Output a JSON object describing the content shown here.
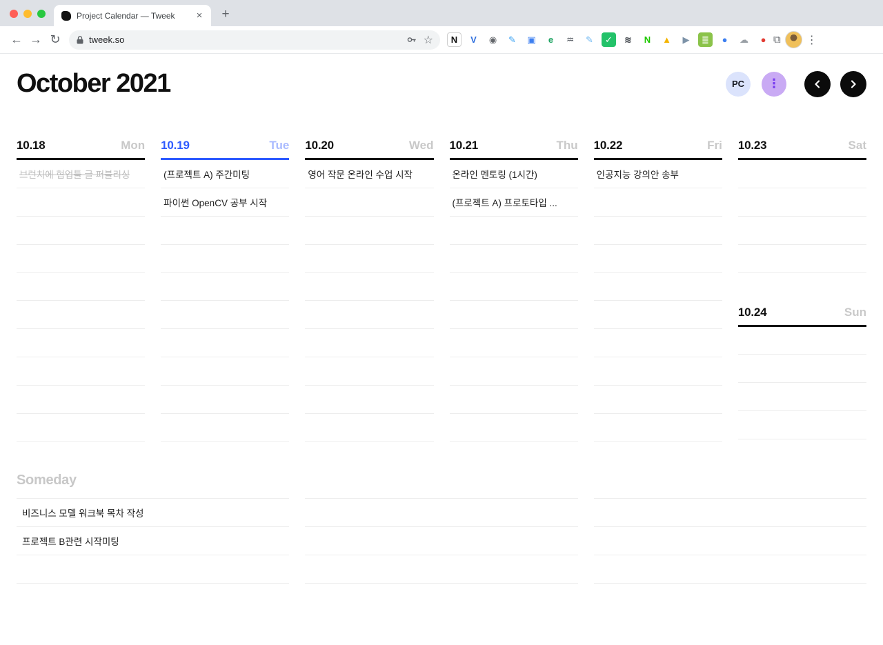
{
  "browser": {
    "tab": {
      "title": "Project Calendar — Tweek"
    },
    "new_tab_label": "+",
    "close_tab_label": "×",
    "url": "tweek.so",
    "nav": {
      "back": "←",
      "forward": "→",
      "reload": "↻"
    },
    "omnibox_icons": {
      "star": "☆"
    },
    "extensions": [
      {
        "name": "notion-extension-icon",
        "glyph": "N",
        "bg": "#ffffff",
        "fg": "#111111",
        "border": "#cfcfcf"
      },
      {
        "name": "v-blue-extension-icon",
        "glyph": "V",
        "bg": "#ffffff",
        "fg": "#2f6fde"
      },
      {
        "name": "camera-extension-icon",
        "glyph": "◉",
        "bg": "#ffffff",
        "fg": "#63666b"
      },
      {
        "name": "blue-pen-extension-icon",
        "glyph": "✎",
        "bg": "#ffffff",
        "fg": "#38a1f3"
      },
      {
        "name": "blue-app-extension-icon",
        "glyph": "▣",
        "bg": "#ffffff",
        "fg": "#3d7ff0"
      },
      {
        "name": "evernote-extension-icon",
        "glyph": "e",
        "bg": "#ffffff",
        "fg": "#1fa463"
      },
      {
        "name": "wave-extension-icon",
        "glyph": "♒",
        "bg": "#ffffff",
        "fg": "#444a52"
      },
      {
        "name": "feather-extension-icon",
        "glyph": "✎",
        "bg": "#ffffff",
        "fg": "#6db7f2"
      },
      {
        "name": "green-check-extension-icon",
        "glyph": "✓",
        "bg": "#23c269",
        "fg": "#ffffff"
      },
      {
        "name": "sound-wave-extension-icon",
        "glyph": "≋",
        "bg": "#ffffff",
        "fg": "#3a3f45"
      },
      {
        "name": "naver-extension-icon",
        "glyph": "N",
        "bg": "#ffffff",
        "fg": "#1ec800"
      },
      {
        "name": "drive-extension-icon",
        "glyph": "▲",
        "bg": "#ffffff",
        "fg": "#f4b400"
      },
      {
        "name": "send-extension-icon",
        "glyph": "▶",
        "bg": "#ffffff",
        "fg": "#7d93a8"
      },
      {
        "name": "note-extension-icon",
        "glyph": "≣",
        "bg": "#8bc34a",
        "fg": "#ffffff"
      },
      {
        "name": "blue-dot-extension-icon",
        "glyph": "●",
        "bg": "#ffffff",
        "fg": "#3d7ff0"
      },
      {
        "name": "cloud-extension-icon",
        "glyph": "☁",
        "bg": "#ffffff",
        "fg": "#9aa0a6"
      },
      {
        "name": "record-extension-icon",
        "glyph": "●",
        "bg": "#ffffff",
        "fg": "#e23b33"
      }
    ],
    "puzzle_glyph": "⧉",
    "menu_glyph": "⋮"
  },
  "page": {
    "title": "October 2021",
    "controls": {
      "pc_label": "PC",
      "more_glyph": "⋮"
    }
  },
  "calendar": {
    "columns": [
      {
        "days": [
          {
            "date": "10.18",
            "name": "Mon",
            "today": false,
            "rows": 10,
            "tasks": [
              {
                "text": "브런치에 협업툴 글 퍼블리싱",
                "done": true
              }
            ]
          }
        ]
      },
      {
        "days": [
          {
            "date": "10.19",
            "name": "Tue",
            "today": true,
            "rows": 10,
            "tasks": [
              {
                "text": "(프로젝트 A) 주간미팅",
                "done": false
              },
              {
                "text": "파이썬 OpenCV 공부 시작",
                "done": false
              }
            ]
          }
        ]
      },
      {
        "days": [
          {
            "date": "10.20",
            "name": "Wed",
            "today": false,
            "rows": 10,
            "tasks": [
              {
                "text": "영어 작문 온라인 수업 시작",
                "done": false
              }
            ]
          }
        ]
      },
      {
        "days": [
          {
            "date": "10.21",
            "name": "Thu",
            "today": false,
            "rows": 10,
            "tasks": [
              {
                "text": "온라인 멘토링 (1시간)",
                "done": false
              },
              {
                "text": "(프로젝트 A) 프로토타입 ...",
                "done": false
              }
            ]
          }
        ]
      },
      {
        "days": [
          {
            "date": "10.22",
            "name": "Fri",
            "today": false,
            "rows": 10,
            "tasks": [
              {
                "text": "인공지능 강의안 송부",
                "done": false
              }
            ]
          }
        ]
      },
      {
        "days": [
          {
            "date": "10.23",
            "name": "Sat",
            "today": false,
            "rows": 4,
            "tasks": []
          },
          {
            "date": "10.24",
            "name": "Sun",
            "today": false,
            "rows": 4,
            "tasks": []
          }
        ]
      }
    ]
  },
  "someday": {
    "title": "Someday",
    "columns": [
      {
        "rows": 3,
        "tasks": [
          "비즈니스 모델 워크북 목차 작성",
          "프로젝트 B관련 시작미팅"
        ]
      },
      {
        "rows": 3,
        "tasks": []
      },
      {
        "rows": 3,
        "tasks": []
      }
    ]
  },
  "colors": {
    "today_accent": "#2e5bff",
    "today_dayname": "#a9baff",
    "done_task": "#bdbdbd",
    "pc_button_bg": "#dbe3fc",
    "more_button_bg": "#c9aaf4",
    "more_button_fg": "#7a3df0",
    "nav_button_bg": "#0b0b0b",
    "header_underline": "#141414",
    "row_divider": "#ededed"
  }
}
